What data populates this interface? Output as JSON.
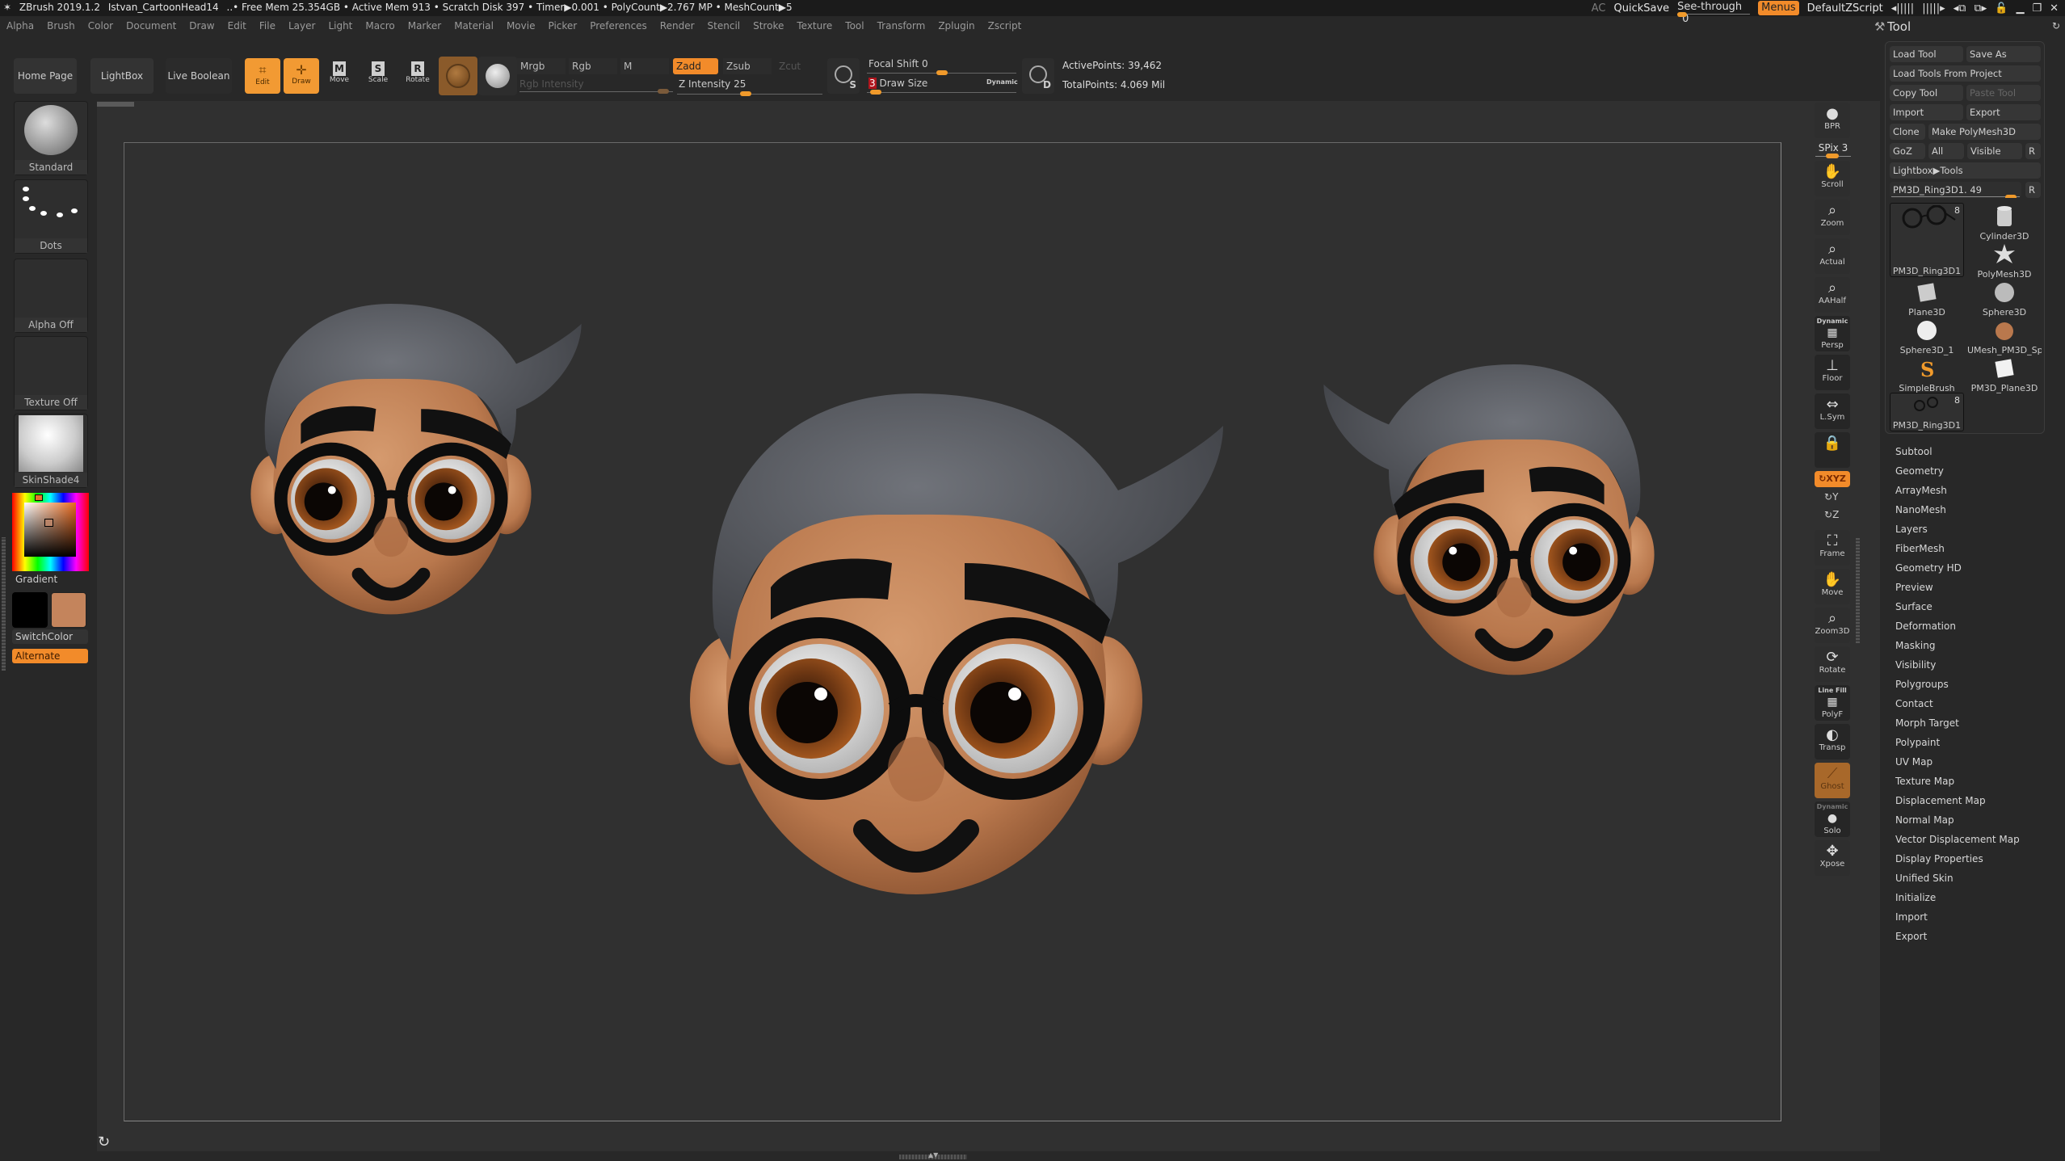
{
  "titlebar": {
    "app": "ZBrush 2019.1.2",
    "document": "Istvan_CartoonHead14",
    "stats": "..• Free Mem 25.354GB • Active Mem 913 • Scratch Disk 397 • Timer▶0.001 • PolyCount▶2.767 MP • MeshCount▶5",
    "ac": "AC",
    "quicksave": "QuickSave",
    "see_through_label": "See-through",
    "see_through_value": "0",
    "see_through_fraction": 0,
    "menus": "Menus",
    "default_zscript": "DefaultZScript",
    "window_icons": [
      "◂|||||",
      "|||||▸",
      "◂⧉",
      "⧉▸",
      "🔓",
      "▁",
      "❐",
      "✕"
    ]
  },
  "menubar": [
    "Alpha",
    "Brush",
    "Color",
    "Document",
    "Draw",
    "Edit",
    "File",
    "Layer",
    "Light",
    "Macro",
    "Marker",
    "Material",
    "Movie",
    "Picker",
    "Preferences",
    "Render",
    "Stencil",
    "Stroke",
    "Texture",
    "Tool",
    "Transform",
    "Zplugin",
    "Zscript"
  ],
  "shelf": {
    "home_page": "Home Page",
    "lightbox": "LightBox",
    "live_boolean": "Live Boolean",
    "edit": "Edit",
    "draw": "Draw",
    "move": "Move",
    "scale": "Scale",
    "rotate": "Rotate",
    "mrgb": "Mrgb",
    "rgb": "Rgb",
    "m": "M",
    "zadd": "Zadd",
    "zsub": "Zsub",
    "zcut": "Zcut",
    "rgb_intensity_label": "Rgb Intensity",
    "z_intensity_label": "Z Intensity",
    "z_intensity_value": "25",
    "focal_shift_label": "Focal Shift",
    "focal_shift_value": "0",
    "draw_size_value": "3",
    "draw_size_label": "Draw Size",
    "dynamic": "Dynamic",
    "s_label": "S",
    "d_label": "D",
    "active_points": "ActivePoints: 39,462",
    "total_points": "TotalPoints: 4.069 Mil"
  },
  "left_shelf": {
    "brush": "Standard",
    "stroke": "Dots",
    "alpha": "Alpha Off",
    "texture": "Texture Off",
    "material": "SkinShade4",
    "gradient": "Gradient",
    "switch_color": "SwitchColor",
    "alternate": "Alternate",
    "primary_color": "#000000",
    "secondary_color": "#c4845c"
  },
  "right_shelf": {
    "bpr": "BPR",
    "spix": "SPix 3",
    "scroll": "Scroll",
    "zoom": "Zoom",
    "actual": "Actual",
    "aahalf": "AAHalf",
    "persp_top": "Dynamic",
    "persp": "Persp",
    "floor": "Floor",
    "lsym": "L.Sym",
    "xyz": "XYZ",
    "y": "Y",
    "z": "Z",
    "frame": "Frame",
    "move": "Move",
    "zoom3d": "Zoom3D",
    "rotate": "Rotate",
    "polyf_top": "Line Fill",
    "polyf": "PolyF",
    "transp": "Transp",
    "ghost": "Ghost",
    "solo_top": "Dynamic",
    "solo": "Solo",
    "xpose": "Xpose"
  },
  "tool_palette": {
    "title": "Tool",
    "load_tool": "Load Tool",
    "save_as": "Save As",
    "load_tools_from_project": "Load Tools From Project",
    "copy_tool": "Copy Tool",
    "paste_tool": "Paste Tool",
    "import": "Import",
    "export": "Export",
    "clone": "Clone",
    "make_polymesh": "Make PolyMesh3D",
    "goz": "GoZ",
    "all": "All",
    "visible": "Visible",
    "r": "R",
    "lightbox_tools": "Lightbox▶Tools",
    "current_tool": "PM3D_Ring3D1. 49",
    "current_tool_slider_fraction": 0.9,
    "tools": [
      {
        "name": "PM3D_Ring3D1",
        "count": "8",
        "selected": true
      },
      {
        "name": "Cylinder3D"
      },
      {
        "name": "PolyMesh3D"
      },
      {
        "name": "Plane3D"
      },
      {
        "name": "Sphere3D"
      },
      {
        "name": "Sphere3D_1"
      },
      {
        "name": "UMesh_PM3D_Sp"
      },
      {
        "name": "SimpleBrush"
      },
      {
        "name": "PM3D_Plane3D"
      },
      {
        "name": "PM3D_Ring3D1",
        "count": "8"
      }
    ],
    "subpalettes": [
      "Subtool",
      "Geometry",
      "ArrayMesh",
      "NanoMesh",
      "Layers",
      "FiberMesh",
      "Geometry HD",
      "Preview",
      "Surface",
      "Deformation",
      "Masking",
      "Visibility",
      "Polygroups",
      "Contact",
      "Morph Target",
      "Polypaint",
      "UV Map",
      "Texture Map",
      "Displacement Map",
      "Normal Map",
      "Vector Displacement Map",
      "Display Properties",
      "Unified Skin",
      "Initialize",
      "Import",
      "Export"
    ]
  },
  "colors": {
    "accent": "#f29a33",
    "skin": "#c4845c",
    "hair": "#5b5d62"
  }
}
